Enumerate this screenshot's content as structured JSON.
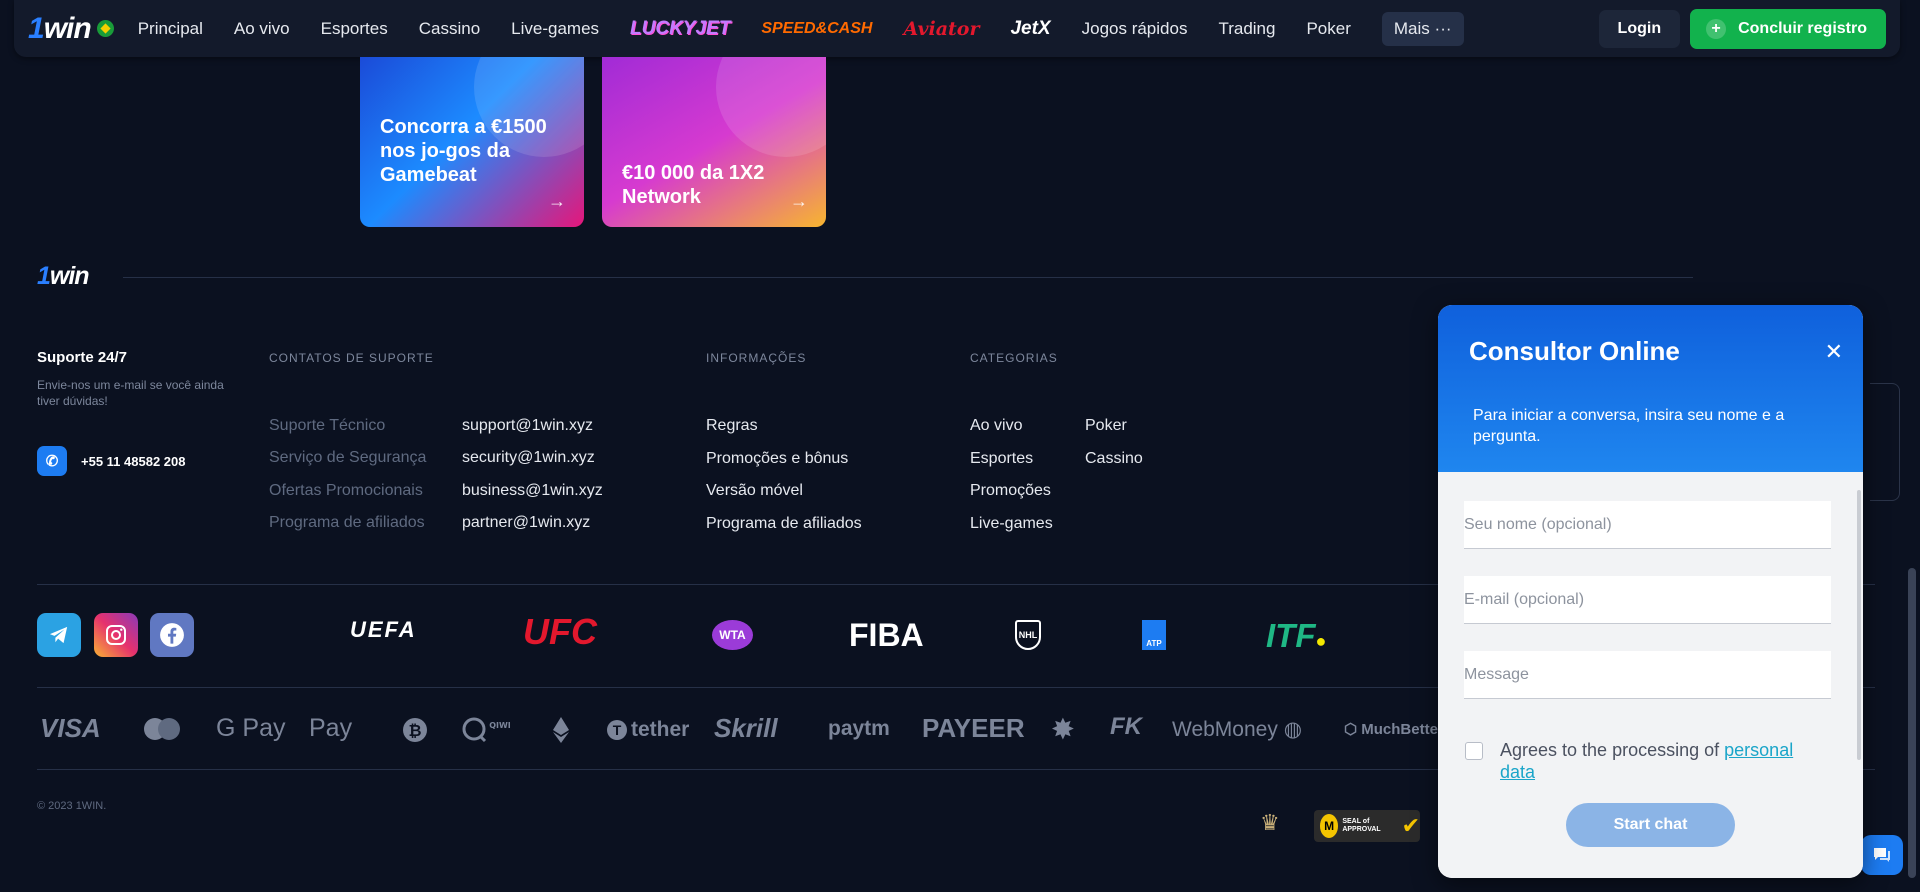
{
  "header": {
    "logo": "1win",
    "nav": [
      "Principal",
      "Ao vivo",
      "Esportes",
      "Cassino",
      "Live-games"
    ],
    "brands": [
      "LUCKYJET",
      "SPEED&CASH",
      "Aviator",
      "JetX"
    ],
    "nav2": [
      "Jogos rápidos",
      "Trading",
      "Poker"
    ],
    "more_label": "Mais",
    "more_icon": "···",
    "login_label": "Login",
    "register_label": "Concluir registro"
  },
  "promos": [
    {
      "text": "Concorra a €1500 nos jo-gos da Gamebeat"
    },
    {
      "text": "€10 000 da 1X2 Network"
    }
  ],
  "footer": {
    "logo": "1win",
    "support_title": "Suporte 24/7",
    "support_sub": "Envie-nos um e-mail se você ainda tiver dúvidas!",
    "phone": "+55 11 48582 208",
    "contacts_head": "CONTATOS DE SUPORTE",
    "contacts": [
      {
        "label": "Suporte Técnico",
        "email": "support@1win.xyz"
      },
      {
        "label": "Serviço de Segurança",
        "email": "security@1win.xyz"
      },
      {
        "label": "Ofertas Promocionais",
        "email": "business@1win.xyz"
      },
      {
        "label": "Programa de afiliados",
        "email": "partner@1win.xyz"
      }
    ],
    "info_head": "INFORMAÇÕES",
    "info_links": [
      "Regras",
      "Promoções e bônus",
      "Versão móvel",
      "Programa de afiliados"
    ],
    "cat_head": "CATEGORIAS",
    "cat_links_1": [
      "Ao vivo",
      "Esportes",
      "Promoções",
      "Live-games"
    ],
    "cat_links_2": [
      "Poker",
      "Cassino"
    ],
    "sponsors": {
      "uefa": "UEFA",
      "ufc": "UFC",
      "wta": "WTA",
      "fiba": "FIBA",
      "nhl": "NHL",
      "atp": "ATP",
      "itf": "ITF"
    },
    "payments": [
      "VISA",
      "G Pay",
      "Pay",
      "tether",
      "Skrill",
      "paytm",
      "PAYEER",
      "WebMoney",
      "MuchBetter"
    ],
    "copyright": "© 2023 1WIN.",
    "seal_text": "SEAL of APPROVAL"
  },
  "chat": {
    "title": "Consultor Online",
    "intro": "Para iniciar a conversa, insira seu nome e a pergunta.",
    "name_placeholder": "Seu nome (opcional)",
    "email_placeholder": "E-mail (opcional)",
    "message_placeholder": "Message",
    "consent_text": "Agrees to the processing of",
    "consent_link": "personal data",
    "start_label": "Start chat"
  },
  "colors": {
    "accent": "#1d7cf2",
    "register": "#12b24d",
    "background": "#0b1120"
  }
}
